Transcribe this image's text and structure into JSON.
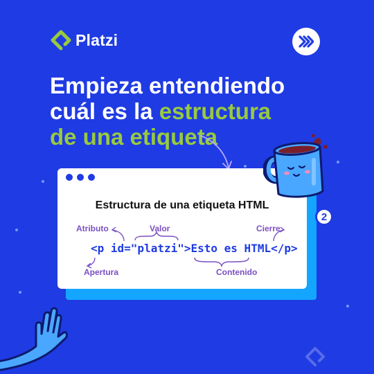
{
  "brand": {
    "name": "Platzi",
    "accent_green": "#98ca3f",
    "background_blue": "#1f3be3"
  },
  "nav": {
    "next_icon": "double-chevron-right-icon"
  },
  "headline": {
    "line1": "Empieza entendiendo",
    "line2_plain": "cuál es la ",
    "line2_green": "estructura",
    "line3_green": "de una etiqueta"
  },
  "card": {
    "title": "Estructura de una etiqueta HTML",
    "code": "<p id=\"platzi\">Esto es HTML</p>",
    "labels": {
      "atributo": "Atributo",
      "valor": "Valor",
      "cierre": "Cierre",
      "apertura": "Apertura",
      "contenido": "Contenido"
    },
    "badge_number": "2"
  }
}
